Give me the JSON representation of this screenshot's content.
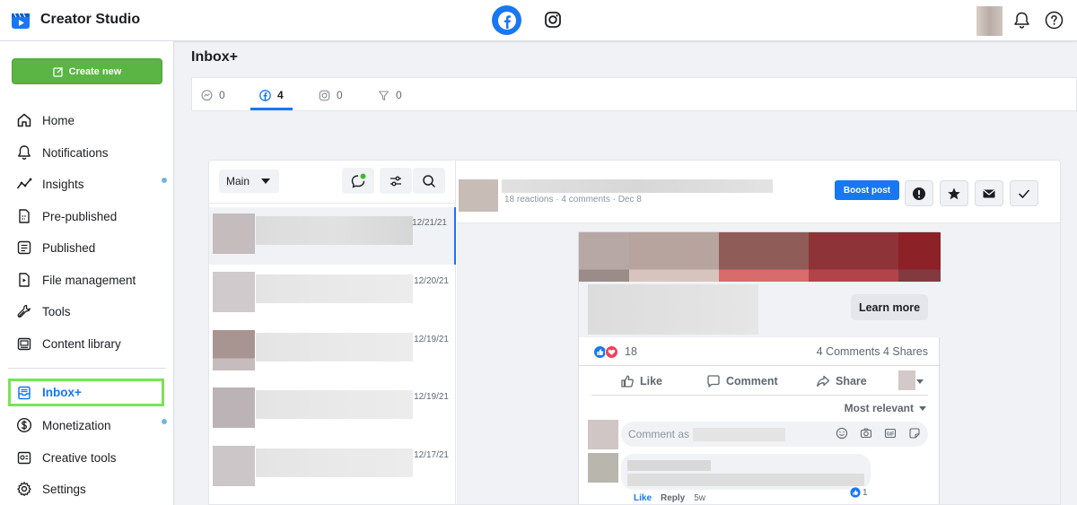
{
  "app": {
    "title": "Creator Studio"
  },
  "sidebar": {
    "create_label": "Create new",
    "items": [
      {
        "label": "Home",
        "icon": "home-icon"
      },
      {
        "label": "Notifications",
        "icon": "bell-icon"
      },
      {
        "label": "Insights",
        "icon": "insights-icon",
        "dot": true
      },
      {
        "label": "Pre-published",
        "icon": "document-icon"
      },
      {
        "label": "Published",
        "icon": "published-icon"
      },
      {
        "label": "File management",
        "icon": "file-icon"
      },
      {
        "label": "Tools",
        "icon": "wrench-icon"
      },
      {
        "label": "Content library",
        "icon": "library-icon"
      },
      {
        "label": "Inbox+",
        "icon": "inbox-icon",
        "active": true
      },
      {
        "label": "Monetization",
        "icon": "dollar-icon",
        "dot": true
      },
      {
        "label": "Creative tools",
        "icon": "creative-tools-icon"
      },
      {
        "label": "Settings",
        "icon": "gear-icon"
      }
    ]
  },
  "page": {
    "title": "Inbox+"
  },
  "tabs": [
    {
      "icon": "messenger-icon",
      "count": "0"
    },
    {
      "icon": "facebook-icon",
      "count": "4",
      "active": true
    },
    {
      "icon": "instagram-icon",
      "count": "0"
    },
    {
      "icon": "filter-icon",
      "count": "0"
    }
  ],
  "inbox": {
    "folder": "Main",
    "conversations": [
      {
        "date": "12/21/21",
        "selected": true
      },
      {
        "date": "12/20/21"
      },
      {
        "date": "12/19/21"
      },
      {
        "date": "12/19/21"
      },
      {
        "date": "12/17/21"
      }
    ]
  },
  "post": {
    "meta": "18 reactions · 4 comments · Dec 8",
    "boost_label": "Boost post",
    "learn_more": "Learn more",
    "reaction_count": "18",
    "comments_shares": "4 Comments  4 Shares",
    "like": "Like",
    "comment": "Comment",
    "share": "Share",
    "sort": "Most relevant",
    "comment_placeholder": "Comment as",
    "reply": {
      "like": "Like",
      "reply": "Reply",
      "time": "5w",
      "reactions": "1"
    }
  },
  "colors": {
    "brand": "#1877f2",
    "create": "#5ab545",
    "highlight": "#7be355"
  }
}
